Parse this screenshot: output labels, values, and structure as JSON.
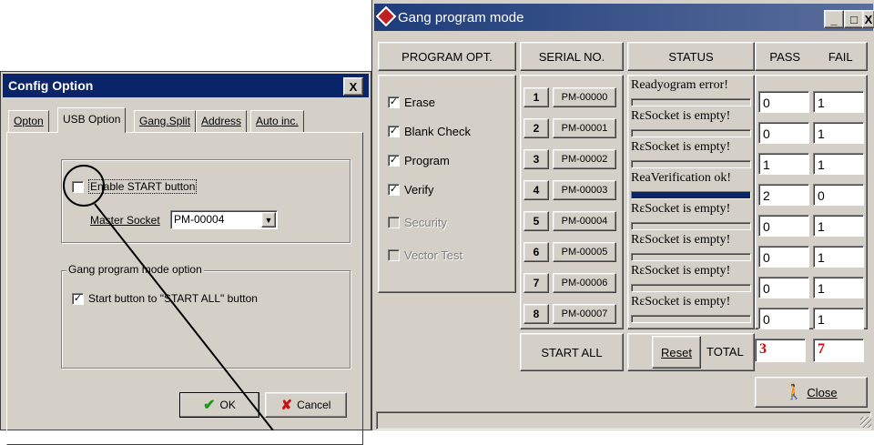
{
  "config": {
    "title": "Config Option",
    "close": "X",
    "tabs": [
      "Opton",
      "USB Option",
      "Gang.Split",
      "Address",
      "Auto inc."
    ],
    "enable_start_label": "Enable START button",
    "master_socket_label": "Master Socket",
    "master_socket_value": "PM-00004",
    "group_title": "Gang program mode option",
    "start_all_option": "Start button to \"START ALL\" button",
    "ok": "OK",
    "cancel": "Cancel"
  },
  "gang": {
    "title": "Gang program mode",
    "window_buttons": [
      "_",
      "□",
      "X"
    ],
    "headers": {
      "program_opt": "PROGRAM OPT.",
      "serial_no": "SERIAL NO.",
      "status": "STATUS",
      "pass": "PASS",
      "fail": "FAIL"
    },
    "options": [
      {
        "label": "Erase",
        "checked": true,
        "disabled": false
      },
      {
        "label": "Blank Check",
        "checked": true,
        "disabled": false
      },
      {
        "label": "Program",
        "checked": true,
        "disabled": false
      },
      {
        "label": "Verify",
        "checked": true,
        "disabled": false
      },
      {
        "label": "Security",
        "checked": false,
        "disabled": true
      },
      {
        "label": "Vector Test",
        "checked": false,
        "disabled": true
      }
    ],
    "sockets": [
      {
        "num": "1",
        "serial": "PM-00000",
        "status": "Readyogram error!",
        "progress": 0,
        "pass": "0",
        "fail": "1"
      },
      {
        "num": "2",
        "serial": "PM-00001",
        "status": "RεSocket is empty!",
        "progress": 0,
        "pass": "0",
        "fail": "1"
      },
      {
        "num": "3",
        "serial": "PM-00002",
        "status": "RεSocket is empty!",
        "progress": 0,
        "pass": "1",
        "fail": "1"
      },
      {
        "num": "4",
        "serial": "PM-00003",
        "status": "ReaVerification ok!",
        "progress": 1,
        "pass": "2",
        "fail": "0"
      },
      {
        "num": "5",
        "serial": "PM-00004",
        "status": "RεSocket is empty!",
        "progress": 0,
        "pass": "0",
        "fail": "1"
      },
      {
        "num": "6",
        "serial": "PM-00005",
        "status": "RεSocket is empty!",
        "progress": 0,
        "pass": "0",
        "fail": "1"
      },
      {
        "num": "7",
        "serial": "PM-00006",
        "status": "RεSocket is empty!",
        "progress": 0,
        "pass": "0",
        "fail": "1"
      },
      {
        "num": "8",
        "serial": "PM-00007",
        "status": "RεSocket is empty!",
        "progress": 0,
        "pass": "0",
        "fail": "1"
      }
    ],
    "start_all": "START ALL",
    "reset": "Reset",
    "total_label": "TOTAL",
    "total_pass": "3",
    "total_fail": "7",
    "close": "Close"
  },
  "colors": {
    "titlebar": "#0a246a",
    "progress": "#0a246a",
    "total_text": "#e00000",
    "face": "#d4d0c8"
  }
}
